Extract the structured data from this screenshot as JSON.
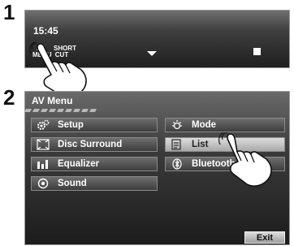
{
  "steps": [
    "1",
    "2"
  ],
  "screen1": {
    "time": "15:45",
    "av_menu_line1": "AV",
    "av_menu_line2": "MENU",
    "shortcut_line1": "SHORT",
    "shortcut_line2": "CUT"
  },
  "screen2": {
    "title": "AV Menu",
    "left_items": [
      {
        "label": "Setup",
        "icon": "gear-icon"
      },
      {
        "label": "Disc Surround",
        "icon": "surround-icon"
      },
      {
        "label": "Equalizer",
        "icon": "equalizer-icon"
      },
      {
        "label": "Sound",
        "icon": "sound-icon"
      }
    ],
    "right_items": [
      {
        "label": "Mode",
        "icon": "mode-icon"
      },
      {
        "label": "List",
        "icon": "list-icon",
        "selected": true
      },
      {
        "label": "Bluetooth",
        "icon": "bluetooth-icon"
      }
    ],
    "exit_label": "Exit"
  },
  "colors": {
    "screen_bg": "#2a2a2a",
    "selected_bg": "#c8c8c8",
    "text": "#ffffff"
  }
}
